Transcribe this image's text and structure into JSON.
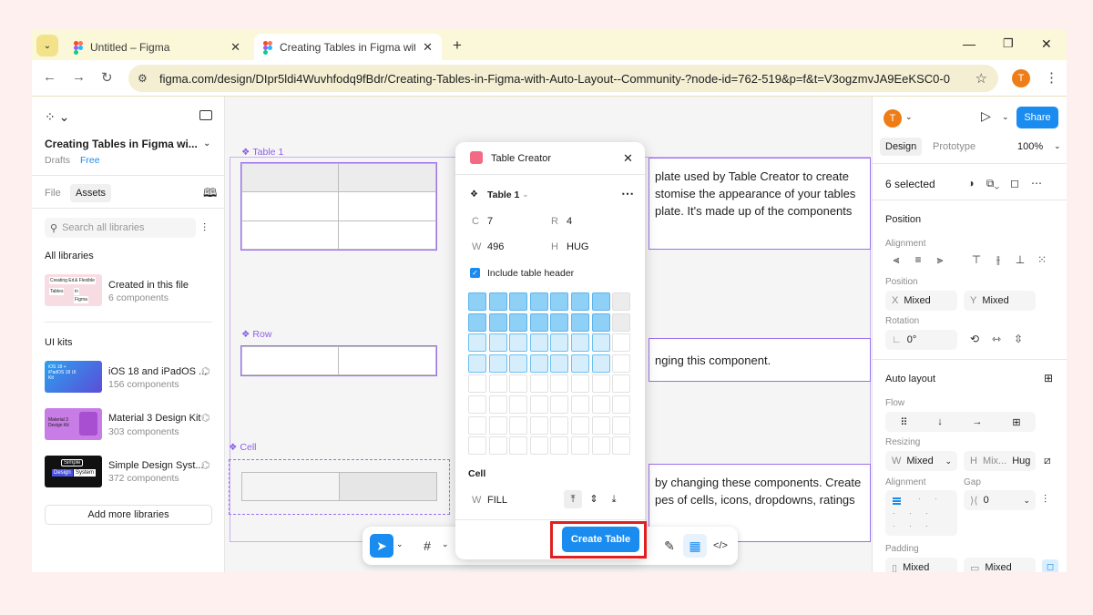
{
  "browser": {
    "tabs": [
      {
        "title": "Untitled – Figma",
        "close": "✕"
      },
      {
        "title": "Creating Tables in Figma with A",
        "close": "✕"
      }
    ],
    "new_tab": "+",
    "url": "figma.com/design/DIpr5ldi4Wuvhfodq9fBdr/Creating-Tables-in-Figma-with-Auto-Layout--Community-?node-id=762-519&p=f&t=V3ogzmvJA9EeKSC0-0",
    "profile_initial": "T"
  },
  "left_panel": {
    "file_title": "Creating Tables in Figma wi...",
    "drafts": "Drafts",
    "plan": "Free",
    "tabs": [
      "File",
      "Assets"
    ],
    "search_placeholder": "Search all libraries",
    "all_libraries": "All libraries",
    "this_file": {
      "name": "Created in this file",
      "count": "6 components",
      "thumb": {
        "a": "Creating Editable",
        "b": "& Flexible",
        "c": "Tables",
        "d": "in",
        "e": "Figma"
      }
    },
    "ui_kits_heading": "UI kits",
    "kits": [
      {
        "name": "iOS 18 and iPadOS ...",
        "count": "156 components",
        "thumb": "iOS 18 + iPadOS 18 UI Kit"
      },
      {
        "name": "Material 3 Design Kit",
        "count": "303 components",
        "thumb": "Material 3 Design Kit"
      },
      {
        "name": "Simple Design Syst...",
        "count": "372 components",
        "thumb_a": "Simple",
        "thumb_b": "Design",
        "thumb_c": "System"
      }
    ],
    "add_more": "Add more libraries"
  },
  "canvas": {
    "labels": {
      "table": "Table 1",
      "row": "Row",
      "cell": "Cell"
    },
    "text1": [
      "plate used by Table Creator to create",
      "stomise the appearance of your tables",
      "plate. It's made up of the components"
    ],
    "text2": [
      "nging this component."
    ],
    "text3": [
      "by changing these components. Create",
      "pes of cells, icons, dropdowns, ratings"
    ]
  },
  "plugin": {
    "title": "Table Creator",
    "table_name": "Table 1",
    "c_label": "C",
    "c_value": "7",
    "r_label": "R",
    "r_value": "4",
    "w_label": "W",
    "w_value": "496",
    "h_label": "H",
    "h_value": "HUG",
    "include_header": "Include table header",
    "grid": {
      "cols": 8,
      "rows": 8,
      "selected_cols": 7,
      "selected_rows": 4,
      "header_rows": 2
    },
    "cell_heading": "Cell",
    "cell_w_label": "W",
    "cell_w_value": "FILL",
    "create_button": "Create Table"
  },
  "right_panel": {
    "avatar": "T",
    "share": "Share",
    "tabs": [
      "Design",
      "Prototype"
    ],
    "zoom": "100%",
    "selection": "6 selected",
    "position_heading": "Position",
    "alignment_label": "Alignment",
    "position_label": "Position",
    "x_label": "X",
    "x_value": "Mixed",
    "y_label": "Y",
    "y_value": "Mixed",
    "rotation_label": "Rotation",
    "rotation_value": "0°",
    "auto_layout_heading": "Auto layout",
    "flow_label": "Flow",
    "resizing_label": "Resizing",
    "w_label": "W",
    "w_value": "Mixed",
    "h_label": "H",
    "h_value": "Mix...",
    "h_extra": "Hug",
    "alignment2_label": "Alignment",
    "gap_label": "Gap",
    "gap_value": "0",
    "padding_label": "Padding",
    "pad_h": "Mixed",
    "pad_v": "Mixed"
  },
  "colors": {
    "accent": "#1a8cf0",
    "selection": "#9d70ee",
    "highlight": "#e02020"
  }
}
